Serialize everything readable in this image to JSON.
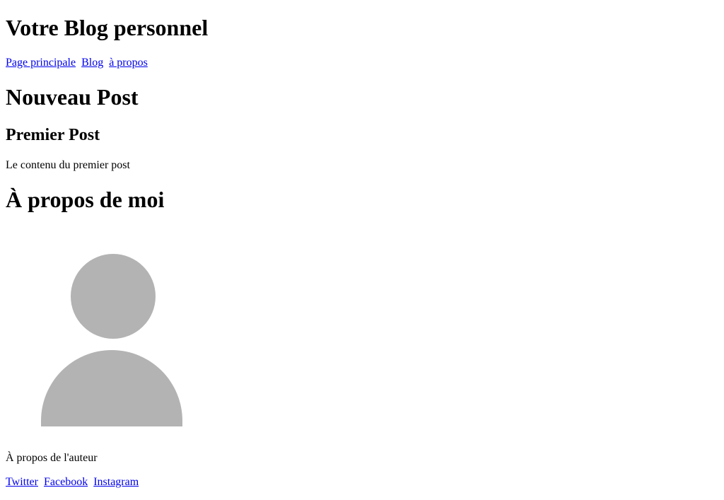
{
  "header": {
    "title": "Votre Blog personnel"
  },
  "nav": {
    "home": "Page principale",
    "blog": "Blog",
    "about": "à propos"
  },
  "posts": {
    "section_heading": "Nouveau Post",
    "post_title": "Premier Post",
    "post_content": "Le contenu du premier post"
  },
  "about": {
    "heading": "À propos de moi",
    "author_text": "À propos de l'auteur"
  },
  "social": {
    "twitter": "Twitter",
    "facebook": "Facebook",
    "instagram": "Instagram"
  }
}
